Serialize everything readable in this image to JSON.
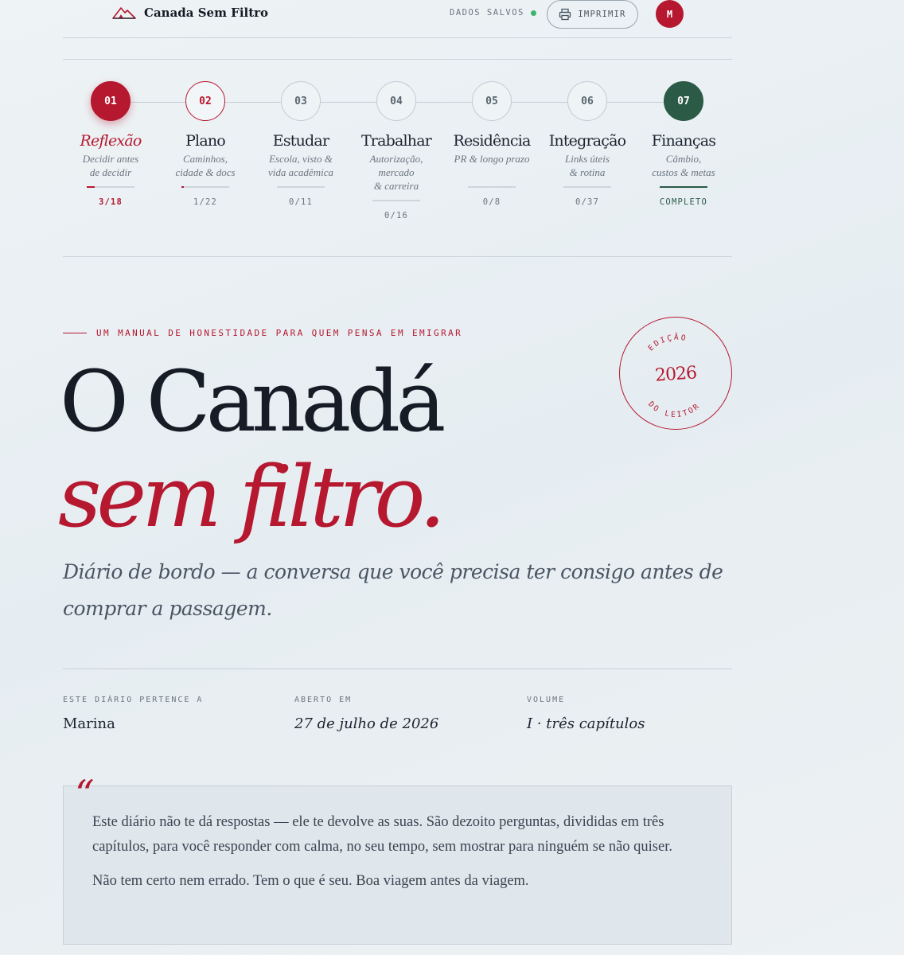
{
  "header": {
    "brand_name": "Canada Sem Filtro",
    "saved_label": "DADOS SALVOS",
    "print_label": "IMPRIMIR",
    "avatar_initial": "M"
  },
  "steps": [
    {
      "num": "01",
      "title": "Reflexão",
      "sub1": "Decidir antes",
      "sub2": "de decidir",
      "sub3": "",
      "count": "3/18",
      "progress": 0.17,
      "state": "active"
    },
    {
      "num": "02",
      "title": "Plano",
      "sub1": "Caminhos,",
      "sub2": "cidade & docs",
      "sub3": "",
      "count": "1/22",
      "progress": 0.05,
      "state": "visited"
    },
    {
      "num": "03",
      "title": "Estudar",
      "sub1": "Escola, visto &",
      "sub2": "vida acadêmica",
      "sub3": "",
      "count": "0/11",
      "progress": 0,
      "state": "todo"
    },
    {
      "num": "04",
      "title": "Trabalhar",
      "sub1": "Autorização,",
      "sub2": "mercado",
      "sub3": "& carreira",
      "count": "0/16",
      "progress": 0,
      "state": "todo"
    },
    {
      "num": "05",
      "title": "Residência",
      "sub1": "PR & longo prazo",
      "sub2": "",
      "sub3": "",
      "count": "0/8",
      "progress": 0,
      "state": "todo"
    },
    {
      "num": "06",
      "title": "Integração",
      "sub1": "Links úteis",
      "sub2": "& rotina",
      "sub3": "",
      "count": "0/37",
      "progress": 0,
      "state": "todo"
    },
    {
      "num": "07",
      "title": "Finanças",
      "sub1": "Câmbio,",
      "sub2": "custos & metas",
      "sub3": "",
      "count": "COMPLETO",
      "progress": 1,
      "state": "done"
    }
  ],
  "hero": {
    "eyebrow": "UM MANUAL DE HONESTIDADE PARA QUEM PENSA EM EMIGRAR",
    "title_line1": "O Canadá",
    "title_line2": "sem filtro.",
    "subtitle": "Diário de bordo — a conversa que você precisa ter consigo antes de comprar a passagem.",
    "stamp_top": "EDIÇÃO",
    "stamp_year": "2026",
    "stamp_bottom": "DO LEITOR"
  },
  "meta": {
    "owner_label": "ESTE DIÁRIO PERTENCE A",
    "owner_value": "Marina",
    "opened_label": "ABERTO EM",
    "opened_value": "27 de julho de 2026",
    "volume_label": "VOLUME",
    "volume_value": "I · três capítulos"
  },
  "quote": {
    "mark": "“",
    "p1": "Este diário não te dá respostas — ele te devolve as suas. São dezoito perguntas, divididas em três capítulos, para você responder com calma, no seu tempo, sem mostrar para ninguém se não quiser.",
    "p2": "Não tem certo nem errado. Tem o que é seu. Boa viagem antes da viagem."
  },
  "colors": {
    "accent": "#b5182f",
    "done": "#2b5a46",
    "saved_dot": "#3fb26b"
  }
}
